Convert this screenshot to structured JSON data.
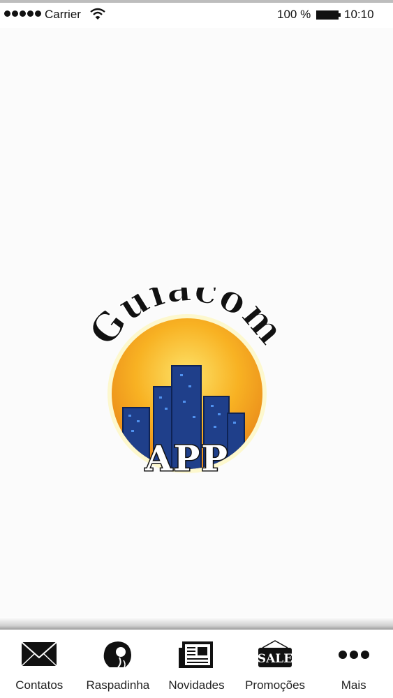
{
  "status_bar": {
    "carrier": "Carrier",
    "battery_percent": "100 %",
    "time": "10:10"
  },
  "splash": {
    "logo_top_text": "Guiacom",
    "logo_bottom_text": "APP",
    "colors": {
      "sun_yellow": "#f8b223",
      "building_blue": "#1f3f8a",
      "outline": "#111111"
    }
  },
  "tab_bar": {
    "tabs": [
      {
        "label": "Contatos",
        "icon": "envelope-icon"
      },
      {
        "label": "Raspadinha",
        "icon": "head-icon"
      },
      {
        "label": "Novidades",
        "icon": "newspaper-icon"
      },
      {
        "label": "Promoções",
        "icon": "sale-tag-icon",
        "icon_text": "SALE"
      },
      {
        "label": "Mais",
        "icon": "more-dots-icon"
      }
    ]
  }
}
